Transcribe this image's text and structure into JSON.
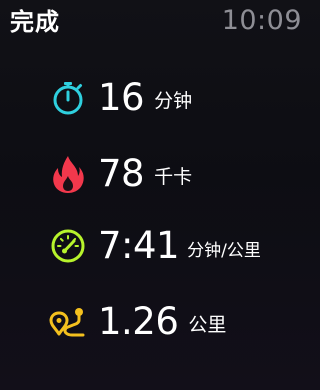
{
  "header": {
    "title": "完成",
    "time": "10:09"
  },
  "metrics": [
    {
      "icon": "stopwatch-icon",
      "color": "#2fd0df",
      "value": "16",
      "unit": "分钟"
    },
    {
      "icon": "flame-icon",
      "color": "#f2384c",
      "value": "78",
      "unit": "千卡"
    },
    {
      "icon": "speedometer-icon",
      "color": "#b7f32c",
      "value": "7:41",
      "unit": "分钟/公里"
    },
    {
      "icon": "route-icon",
      "color": "#f4c01e",
      "value": "1.26",
      "unit": "公里"
    }
  ]
}
